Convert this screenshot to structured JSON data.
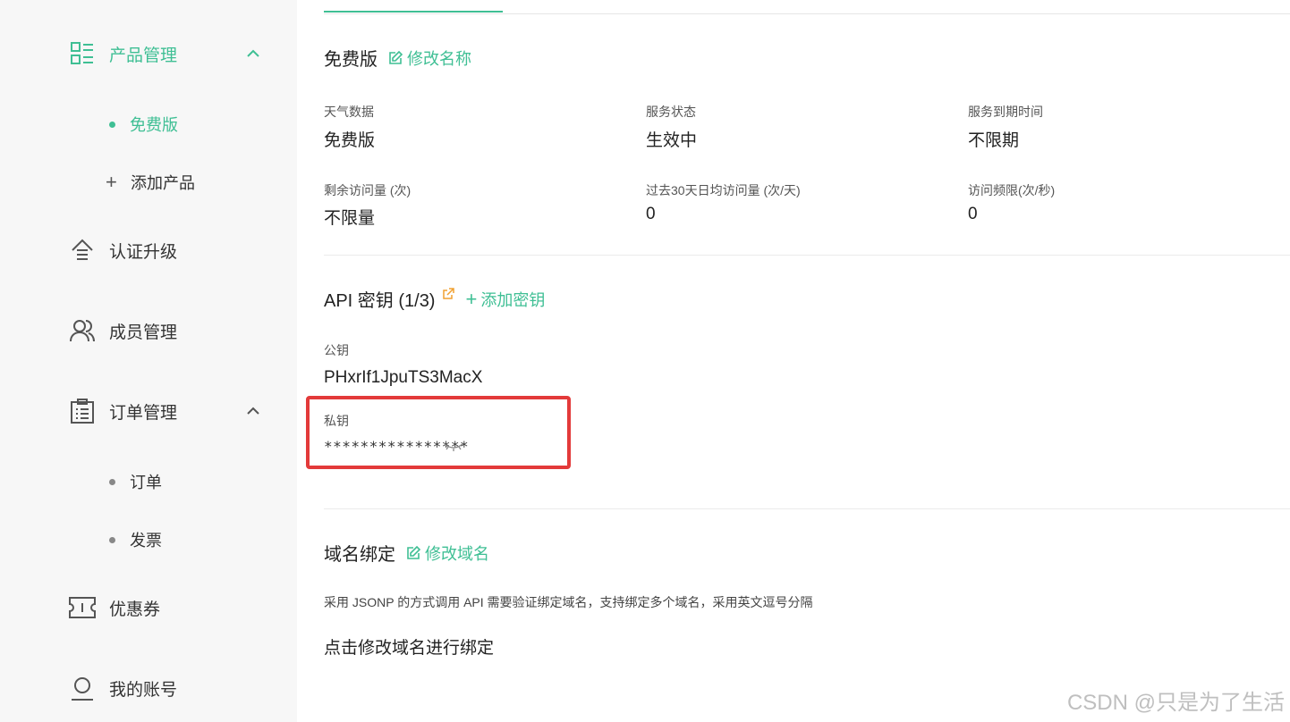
{
  "sidebar": {
    "product_mgmt": "产品管理",
    "free_plan": "免费版",
    "add_product": "添加产品",
    "verify_upgrade": "认证升级",
    "members": "成员管理",
    "order_mgmt": "订单管理",
    "orders": "订单",
    "invoice": "发票",
    "coupon": "优惠券",
    "my_account": "我的账号"
  },
  "plan": {
    "title": "免费版",
    "rename_link": "修改名称",
    "fields": [
      {
        "label": "天气数据",
        "value": "免费版"
      },
      {
        "label": "服务状态",
        "value": "生效中"
      },
      {
        "label": "服务到期时间",
        "value": "不限期"
      },
      {
        "label": "剩余访问量 (次)",
        "value": "不限量"
      },
      {
        "label": "过去30天日均访问量 (次/天)",
        "value": "0"
      },
      {
        "label": "访问频限(次/秒)",
        "value": "0"
      }
    ]
  },
  "api": {
    "title": "API 密钥 (1/3)",
    "add_key_link": "添加密钥",
    "public_key_label": "公钥",
    "public_key_value": "PHxrIf1JpuTS3MacX",
    "private_key_label": "私钥",
    "private_key_masked": "****************"
  },
  "domain": {
    "title": "域名绑定",
    "edit_link": "修改域名",
    "description": "采用 JSONP 的方式调用 API 需要验证绑定域名，支持绑定多个域名，采用英文逗号分隔",
    "hint": "点击修改域名进行绑定"
  },
  "watermark": "CSDN @只是为了生活",
  "colors": {
    "accent": "#3fbf94",
    "highlight_box": "#e33a3a",
    "sidebar_bg": "#f7f7f7"
  }
}
